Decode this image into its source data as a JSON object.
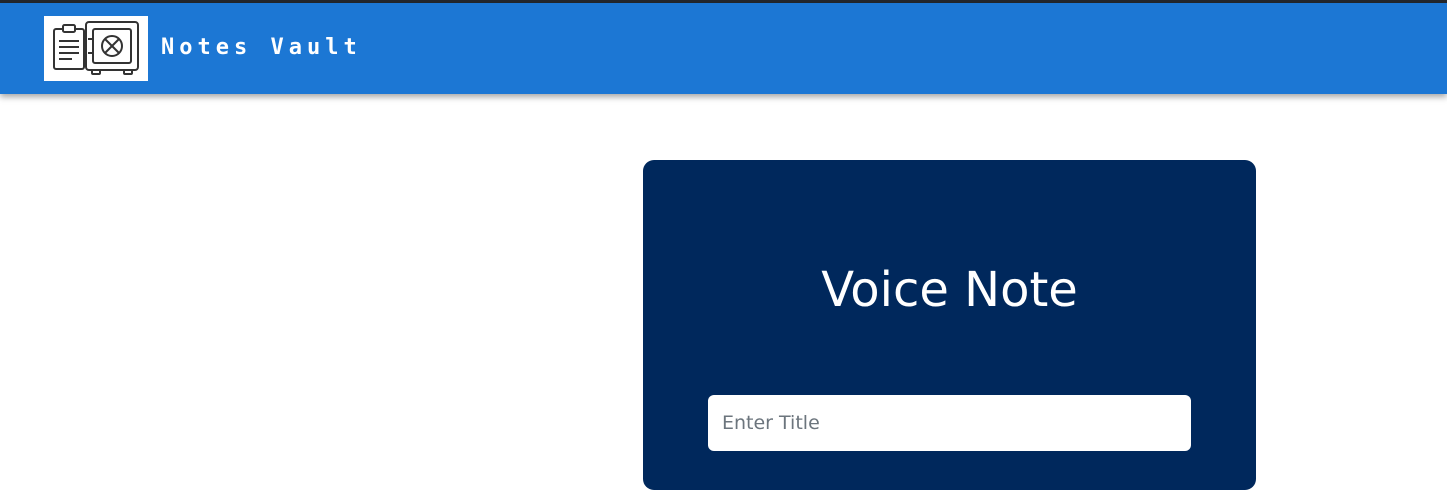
{
  "navbar": {
    "brand": "Notes Vault",
    "color": "#1c77d4",
    "logo_icon": "notes-safe-icon"
  },
  "card": {
    "title": "Voice Note",
    "background": "#00285c",
    "title_input": {
      "placeholder": "Enter Title",
      "value": ""
    }
  }
}
